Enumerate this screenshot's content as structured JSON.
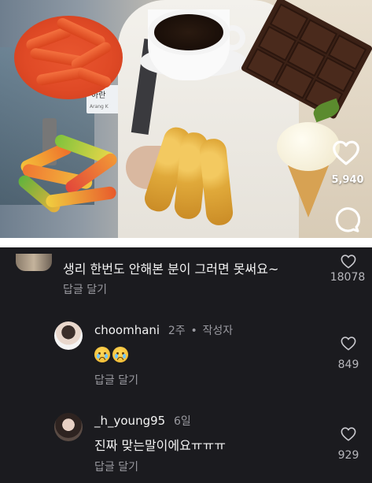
{
  "reel": {
    "like_count": "5,940",
    "sign_text": "아란",
    "sign_subtext": "Arang K"
  },
  "comments": [
    {
      "username": "",
      "text": "생리 한번도 안해본 분이 그러면 못써요~",
      "reply_label": "답글 달기",
      "like_count": "18078"
    },
    {
      "username": "choomhani",
      "age": "2주",
      "separator": "•",
      "badge": "작성자",
      "text_emoji": [
        "crying-face",
        "crying-face"
      ],
      "reply_label": "답글 달기",
      "like_count": "849"
    },
    {
      "username": "_h_young95",
      "age": "6일",
      "text": "진짜 맞는말이에요ㅠㅠㅠ",
      "reply_label": "답글 달기",
      "like_count": "929"
    }
  ],
  "icons": [
    "heart-icon",
    "comment-icon"
  ],
  "colors": {
    "background": "#1b1b1f",
    "text": "#f2f2f2",
    "muted": "#9a9aa0"
  }
}
